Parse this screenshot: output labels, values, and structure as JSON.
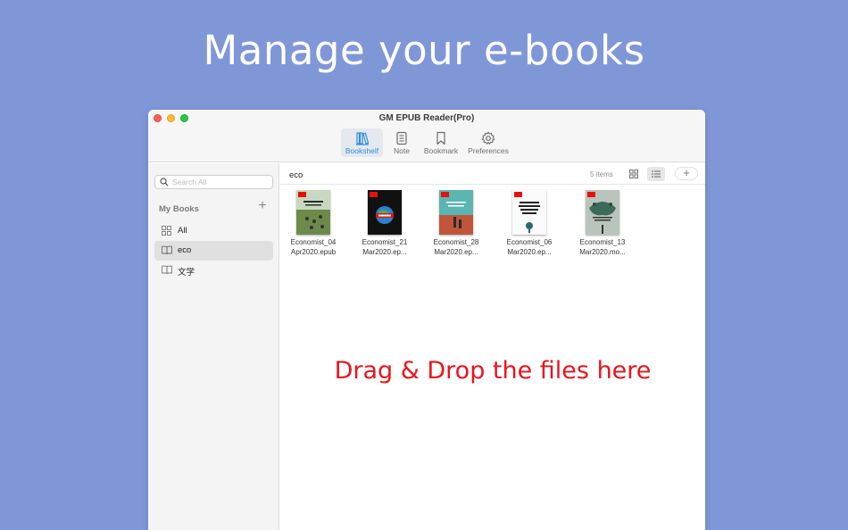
{
  "headline": "Manage your e-books",
  "window": {
    "title": "GM EPUB Reader(Pro)",
    "tabs": [
      {
        "label": "Bookshelf",
        "icon": "bookshelf-icon",
        "active": true
      },
      {
        "label": "Note",
        "icon": "note-icon",
        "active": false
      },
      {
        "label": "Bookmark",
        "icon": "bookmark-icon",
        "active": false
      },
      {
        "label": "Preferences",
        "icon": "gear-icon",
        "active": false
      }
    ]
  },
  "sidebar": {
    "search_placeholder": "Search All",
    "section_title": "My Books",
    "items": [
      {
        "label": "All",
        "icon": "grid-icon",
        "selected": false
      },
      {
        "label": "eco",
        "icon": "book-icon",
        "selected": true
      },
      {
        "label": "文学",
        "icon": "book-icon",
        "selected": false
      }
    ]
  },
  "content": {
    "folder_title": "eco",
    "item_count": "5 items",
    "books": [
      {
        "line1": "Economist_04",
        "line2": "Apr2020.epub"
      },
      {
        "line1": "Economist_21",
        "line2": "Mar2020.ep..."
      },
      {
        "line1": "Economist_28",
        "line2": "Mar2020.ep..."
      },
      {
        "line1": "Economist_06",
        "line2": "Mar2020.ep..."
      },
      {
        "line1": "Economist_13",
        "line2": "Mar2020.mo..."
      }
    ],
    "drop_hint": "Drag & Drop the files here"
  },
  "colors": {
    "background": "#8097d7",
    "accent": "#2f8fd8",
    "drop_hint": "#e8141e",
    "economist_red": "#e3120b"
  }
}
